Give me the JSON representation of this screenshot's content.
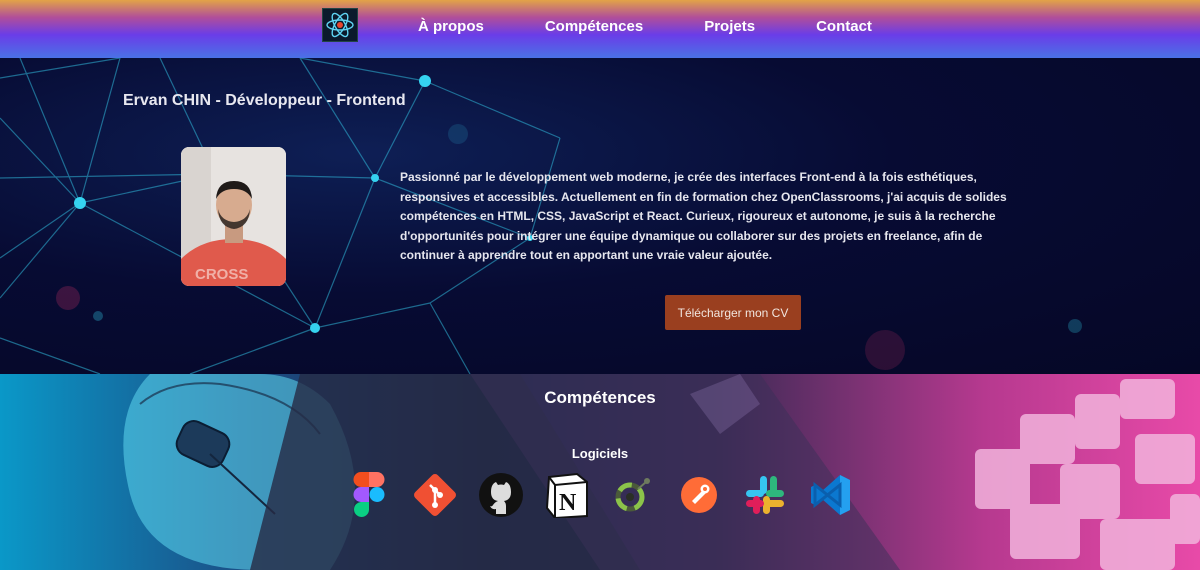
{
  "nav": {
    "logo_icon": "react-atom-logo",
    "links": [
      "À propos",
      "Compétences",
      "Projets",
      "Contact"
    ]
  },
  "hero": {
    "name": "Ervan CHIN - Développeur - Frontend",
    "bio": "Passionné par le développement web moderne, je crée des interfaces Front-end à la fois esthétiques, responsives et accessibles. Actuellement en fin de formation chez OpenClassrooms, j'ai acquis de solides compétences en HTML, CSS, JavaScript et React. Curieux, rigoureux et autonome, je suis à la recherche d'opportunités pour intégrer une équipe dynamique ou collaborer sur des projets en freelance, afin de continuer à apprendre tout en apportant une vraie valeur ajoutée.",
    "cv_button": "Télécharger mon CV",
    "cv_color": "#9a3f1f"
  },
  "skills": {
    "title": "Compétences",
    "subtitle": "Logiciels",
    "icons": [
      "figma-icon",
      "git-icon",
      "github-icon",
      "notion-icon",
      "codacy-icon",
      "postman-icon",
      "slack-icon",
      "vscode-icon"
    ]
  }
}
